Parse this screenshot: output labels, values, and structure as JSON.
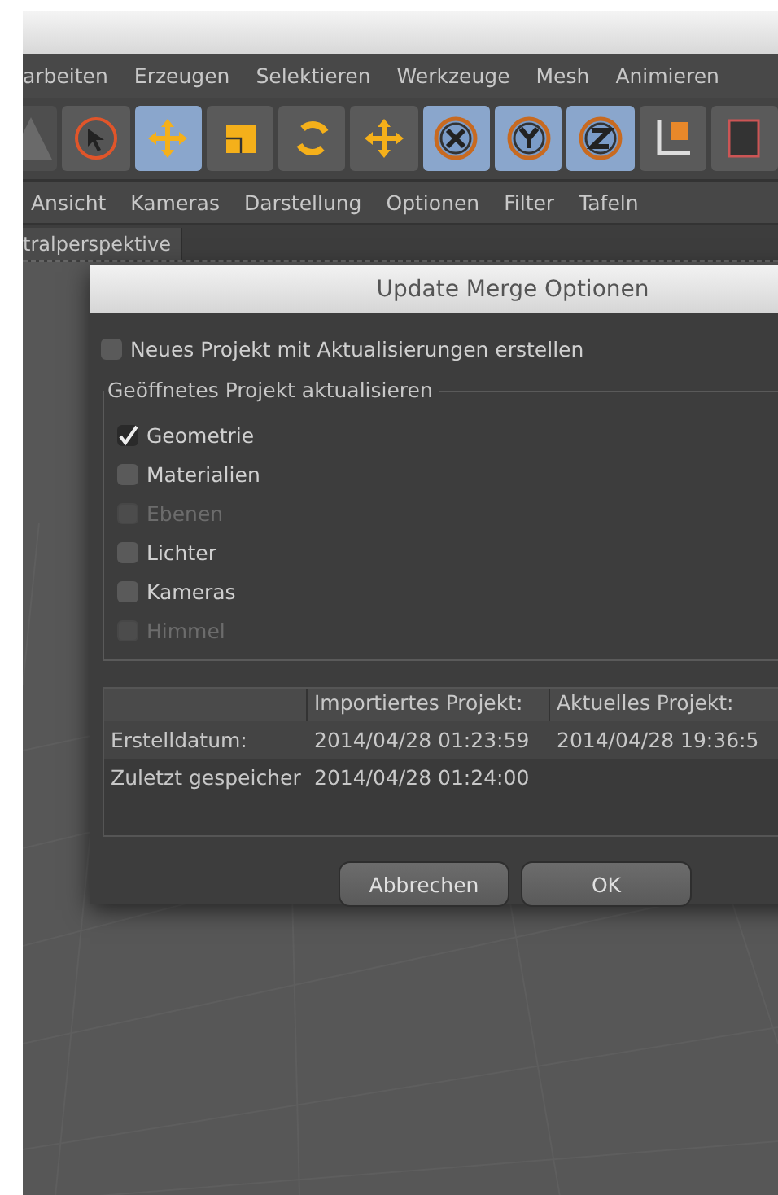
{
  "menu_bar": [
    "arbeiten",
    "Erzeugen",
    "Selektieren",
    "Werkzeuge",
    "Mesh",
    "Animieren"
  ],
  "toolbar": [
    {
      "kind": "undo",
      "selected": false
    },
    {
      "kind": "select",
      "selected": false
    },
    {
      "kind": "move",
      "selected": true
    },
    {
      "kind": "scale",
      "selected": false
    },
    {
      "kind": "rotate",
      "selected": false
    },
    {
      "kind": "add",
      "selected": false
    },
    {
      "kind": "x",
      "selected": true
    },
    {
      "kind": "y",
      "selected": true
    },
    {
      "kind": "z",
      "selected": true
    },
    {
      "kind": "axis",
      "selected": false
    },
    {
      "kind": "render",
      "selected": false
    }
  ],
  "view_menu": [
    "Ansicht",
    "Kameras",
    "Darstellung",
    "Optionen",
    "Filter",
    "Tafeln"
  ],
  "view_tab": "tralperspektive",
  "dialog": {
    "title": "Update Merge Optionen",
    "new_project": {
      "label": "Neues Projekt mit Aktualisierungen erstellen",
      "checked": false,
      "disabled": false
    },
    "group": {
      "title": "Geöffnetes Projekt aktualisieren",
      "items": [
        {
          "label": "Geometrie",
          "checked": true,
          "disabled": false
        },
        {
          "label": "Materialien",
          "checked": false,
          "disabled": false
        },
        {
          "label": "Ebenen",
          "checked": false,
          "disabled": true
        },
        {
          "label": "Lichter",
          "checked": false,
          "disabled": false
        },
        {
          "label": "Kameras",
          "checked": false,
          "disabled": false
        },
        {
          "label": "Himmel",
          "checked": false,
          "disabled": true
        }
      ]
    },
    "table": {
      "columns": [
        "",
        "Importiertes Projekt:",
        "Aktuelles Projekt:"
      ],
      "rows": [
        [
          "Erstelldatum:",
          "2014/04/28 01:23:59",
          "2014/04/28 19:36:5"
        ],
        [
          "Zuletzt gespeicher",
          "2014/04/28 01:24:00"
        ]
      ]
    },
    "buttons": [
      "Abbrechen",
      "OK"
    ]
  }
}
